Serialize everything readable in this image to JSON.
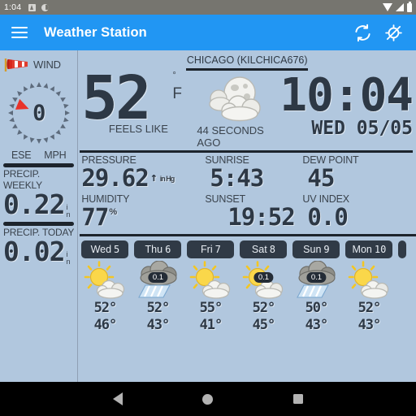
{
  "statusbar": {
    "time": "1:04",
    "icons": [
      "sd-card-icon",
      "brightness-icon"
    ],
    "right_icons": [
      "wifi-icon",
      "signal-icon",
      "battery-icon"
    ]
  },
  "appbar": {
    "menu_icon": "hamburger-menu-icon",
    "title": "Weather Station",
    "refresh_icon": "refresh-icon",
    "location_off_icon": "location-off-icon",
    "bg_color": "#2196f3"
  },
  "wind": {
    "label": "WIND",
    "icon": "windsock-icon",
    "speed": "0",
    "direction": "ESE",
    "unit": "MPH",
    "needle_angle_deg": 202,
    "needle_color": "#e8332a"
  },
  "precip": {
    "weekly_label": "PRECIP. WEEKLY",
    "weekly_value": "0.22",
    "weekly_unit": "in",
    "today_label": "PRECIP. TODAY",
    "today_value": "0.02",
    "today_unit": "in"
  },
  "current": {
    "station": "CHICAGO (KILCHICA676)",
    "temperature": "52",
    "degree_mark": "°",
    "temp_unit": "F",
    "feels_like_label": "FEELS LIKE",
    "condition_icon": "moon-cloud-icon",
    "updated_ago": "44 SECONDS AGO",
    "clock_time": "10:04",
    "clock_date": "WED 05/05"
  },
  "stats": [
    {
      "label": "PRESSURE",
      "value": "29.62",
      "suffix": "",
      "trend": "↑",
      "unit": "in Hg"
    },
    {
      "label": "SUNRISE",
      "value": "5:43",
      "suffix": "",
      "trend": "",
      "unit": ""
    },
    {
      "label": "DEW POINT",
      "value": "45",
      "suffix": "",
      "trend": "",
      "unit": ""
    },
    {
      "label": "HUMIDITY",
      "value": "77",
      "suffix": "%",
      "trend": "",
      "unit": ""
    },
    {
      "label": "SUNSET",
      "value": "19:52",
      "suffix": "",
      "trend": "",
      "unit": ""
    },
    {
      "label": "UV INDEX",
      "value": "0.0",
      "suffix": "",
      "trend": "",
      "unit": ""
    }
  ],
  "forecast": {
    "days": [
      {
        "day": "Wed",
        "date": "5",
        "icon": "sun-cloud-icon",
        "pop": "",
        "high": "52°",
        "low": "46°"
      },
      {
        "day": "Thu",
        "date": "6",
        "icon": "rain-cloud-icon",
        "pop": "0.1",
        "high": "52°",
        "low": "43°"
      },
      {
        "day": "Fri",
        "date": "7",
        "icon": "sun-cloud-icon",
        "pop": "",
        "high": "55°",
        "low": "41°"
      },
      {
        "day": "Sat",
        "date": "8",
        "icon": "sun-cloud-icon",
        "pop": "0.1",
        "high": "52°",
        "low": "45°"
      },
      {
        "day": "Sun",
        "date": "9",
        "icon": "rain-cloud-icon",
        "pop": "0.1",
        "high": "50°",
        "low": "43°"
      },
      {
        "day": "Mon",
        "date": "10",
        "icon": "sun-cloud-icon",
        "pop": "",
        "high": "52°",
        "low": "43°"
      }
    ]
  },
  "navbar": {
    "back": "back-icon",
    "home": "home-icon",
    "recents": "recents-icon"
  },
  "colors": {
    "background": "#b1c7de",
    "accent": "#2196f3",
    "digital_text": "#2d3845",
    "tab_bg": "#303a46"
  }
}
